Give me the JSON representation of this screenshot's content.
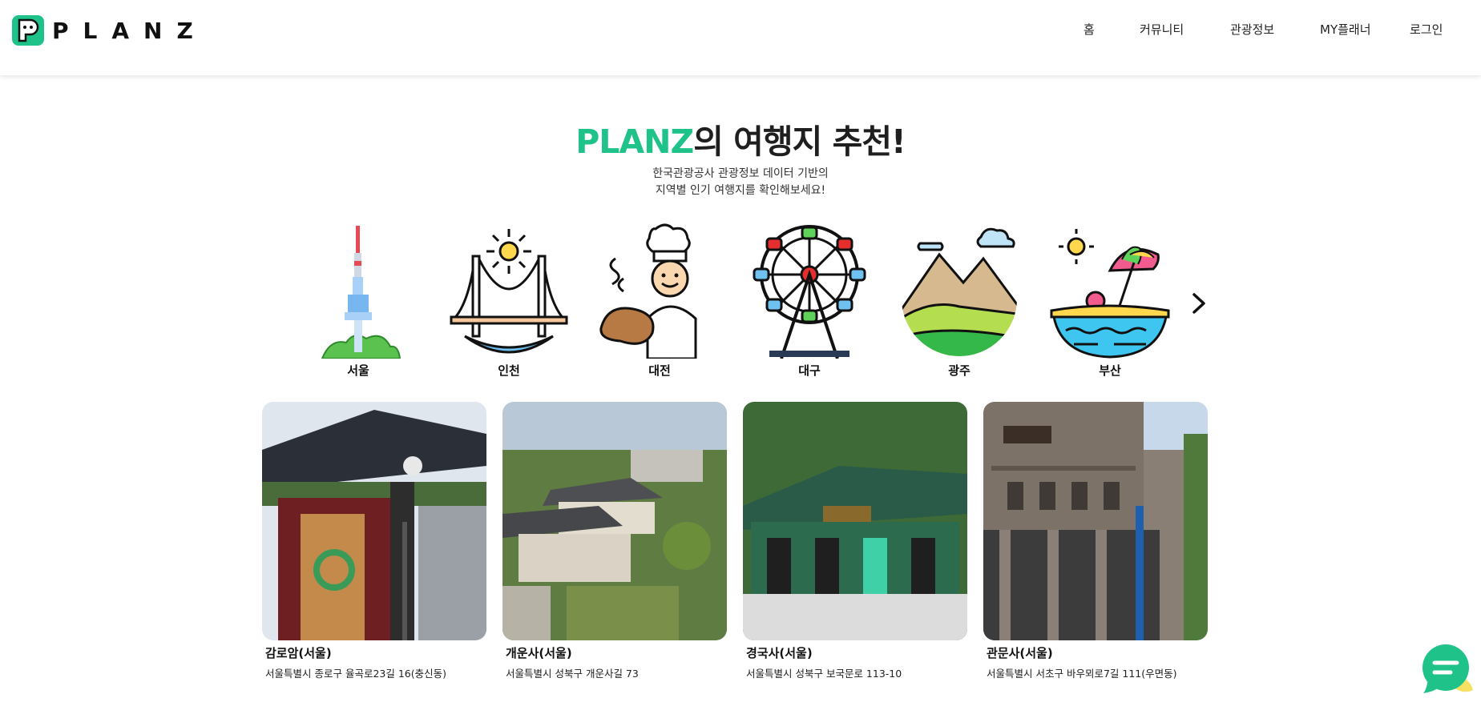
{
  "header": {
    "logo_text": "PLANZ",
    "nav": {
      "home": "홈",
      "community": "커뮤니티",
      "tour_info": "관광정보",
      "my_planner": "MY플래너",
      "login": "로그인"
    }
  },
  "hero": {
    "title_brand": "PLANZ",
    "title_rest": "의 여행지 추천!",
    "subtitle_line1": "한국관광공사 관광정보 데이터 기반의",
    "subtitle_line2": "지역별 인기 여행지를 확인해보세요!"
  },
  "cities": [
    {
      "label": "서울",
      "icon": "namsan-tower-icon"
    },
    {
      "label": "인천",
      "icon": "bridge-icon"
    },
    {
      "label": "대전",
      "icon": "baker-icon"
    },
    {
      "label": "대구",
      "icon": "ferris-wheel-icon"
    },
    {
      "label": "광주",
      "icon": "mountain-icon"
    },
    {
      "label": "부산",
      "icon": "beach-icon"
    }
  ],
  "cards": [
    {
      "title": "감로암(서울)",
      "address": "서울특별시 종로구 율곡로23길 16(충신동)"
    },
    {
      "title": "개운사(서울)",
      "address": "서울특별시 성북구 개운사길 73"
    },
    {
      "title": "경국사(서울)",
      "address": "서울특별시 성북구 보국문로 113-10"
    },
    {
      "title": "관문사(서울)",
      "address": "서울특별시 서초구 바우뫼로7길 111(우면동)"
    }
  ],
  "colors": {
    "brand": "#1fc38a",
    "chat": "#1fc38a"
  }
}
